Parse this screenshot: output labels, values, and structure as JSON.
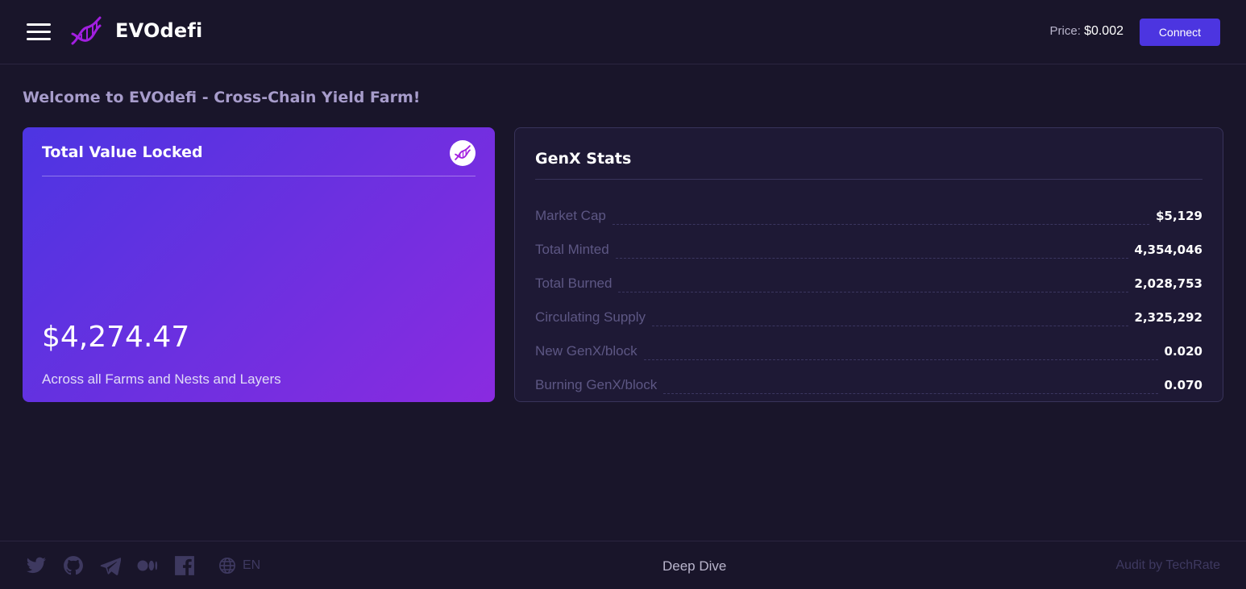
{
  "header": {
    "brand": "EVOdefi",
    "price_label": "Price:",
    "price_value": "$0.002",
    "connect_label": "Connect"
  },
  "welcome": "Welcome to EVOdefi - Cross-Chain Yield Farm!",
  "tvl": {
    "title": "Total Value Locked",
    "value": "$4,274.47",
    "subtitle": "Across all Farms and Nests and Layers"
  },
  "stats": {
    "title": "GenX Stats",
    "rows": [
      {
        "label": "Market Cap",
        "value": "$5,129"
      },
      {
        "label": "Total Minted",
        "value": "4,354,046"
      },
      {
        "label": "Total Burned",
        "value": "2,028,753"
      },
      {
        "label": "Circulating Supply",
        "value": "2,325,292"
      },
      {
        "label": "New GenX/block",
        "value": "0.020"
      },
      {
        "label": "Burning GenX/block",
        "value": "0.070"
      }
    ]
  },
  "footer": {
    "social_icons": [
      "twitter-icon",
      "github-icon",
      "telegram-icon",
      "medium-icon",
      "facebook-icon"
    ],
    "lang": "EN",
    "deep_dive": "Deep Dive",
    "audit": "Audit by TechRate"
  },
  "colors": {
    "background": "#19152a",
    "accent": "#4c35e0",
    "card_gradient_start": "#4d35e2",
    "card_gradient_end": "#8a2be0",
    "logo": "#a21fe0"
  }
}
